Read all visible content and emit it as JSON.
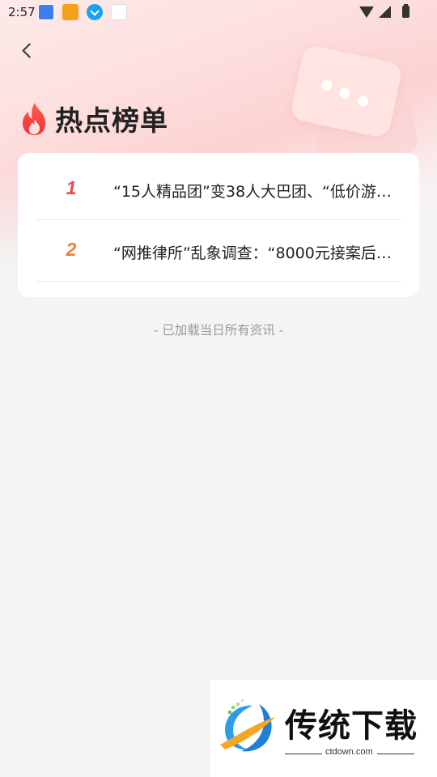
{
  "status_bar": {
    "time": "2:57"
  },
  "header": {
    "title": "热点榜单"
  },
  "hot_list": [
    {
      "rank": "1",
      "title": "“15人精品团”变38人大巴团、“低价游…",
      "rank_color": "#ee4a4a"
    },
    {
      "rank": "2",
      "title": "“网推律所”乱象调查：“8000元接案后…",
      "rank_color": "#f07a3c"
    }
  ],
  "footer": {
    "note": "- 已加载当日所有资讯 -"
  },
  "watermark": {
    "brand": "传统下载",
    "url": "ctdown.com"
  },
  "colors": {
    "background": "#f4f4f4",
    "accent_red": "#ee4a4a",
    "accent_orange": "#f07a3c"
  },
  "icons": [
    "back-arrow-icon",
    "fire-icon",
    "chat-bubble-icon",
    "wifi-icon",
    "signal-icon",
    "battery-icon"
  ]
}
